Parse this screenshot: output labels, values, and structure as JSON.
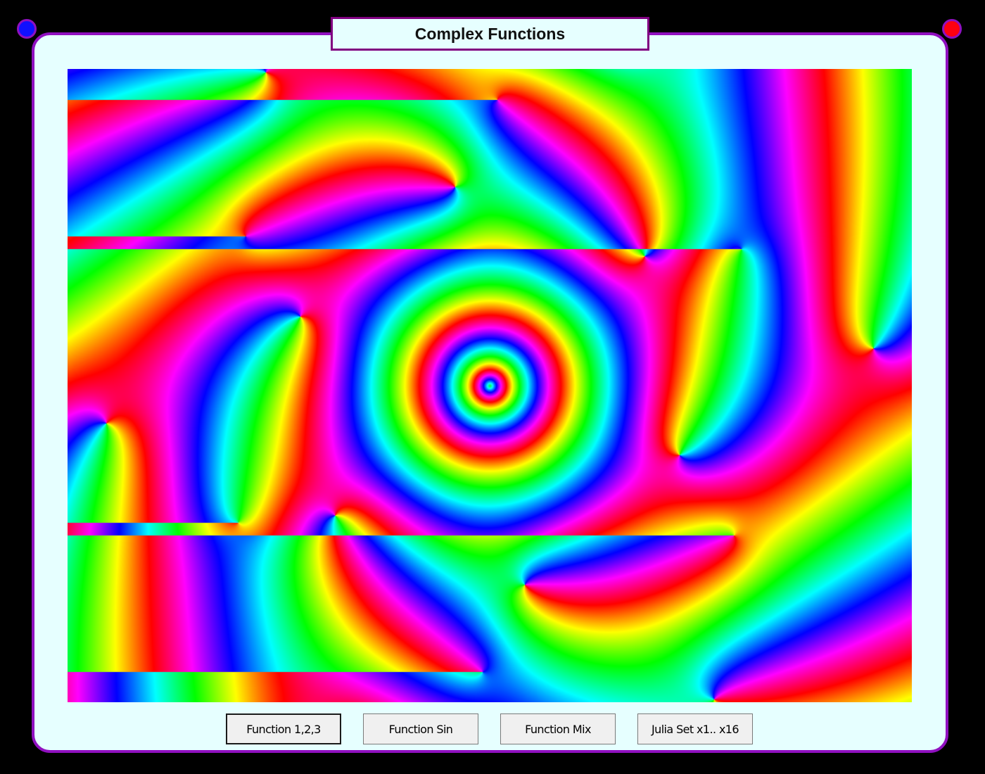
{
  "window": {
    "title": "Complex Functions"
  },
  "corner_dots": {
    "left_color": "#1010ff",
    "right_color": "#ff0010",
    "border_color": "#9010c0"
  },
  "plot": {
    "description_icon": "complex-function-domain-coloring",
    "colormap": "hue-by-argument"
  },
  "buttons": {
    "function_123": "Function 1,2,3",
    "function_sin": "Function Sin",
    "function_mix": "Function Mix",
    "julia_set": "Julia Set x1.. x16"
  },
  "selected_button": "function_123",
  "colors": {
    "background": "#000000",
    "panel": "#e6ffff",
    "panel_border": "#9010c0",
    "title_border": "#800080",
    "button_face": "#f0f0f0"
  }
}
